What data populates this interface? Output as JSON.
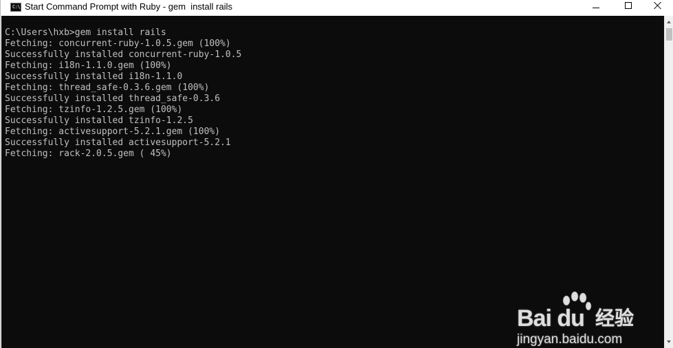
{
  "window": {
    "title": "Start Command Prompt with Ruby - gem  install rails",
    "icon": "cmd-app-icon",
    "icon_text": "C:\\"
  },
  "controls": {
    "minimize": "minimize-icon",
    "maximize": "maximize-icon",
    "close": "close-icon"
  },
  "console": {
    "background": "#0c0c0c",
    "foreground": "#c0c0c0",
    "lines": [
      "C:\\Users\\hxb>gem install rails",
      "Fetching: concurrent-ruby-1.0.5.gem (100%)",
      "Successfully installed concurrent-ruby-1.0.5",
      "Fetching: i18n-1.1.0.gem (100%)",
      "Successfully installed i18n-1.1.0",
      "Fetching: thread_safe-0.3.6.gem (100%)",
      "Successfully installed thread_safe-0.3.6",
      "Fetching: tzinfo-1.2.5.gem (100%)",
      "Successfully installed tzinfo-1.2.5",
      "Fetching: activesupport-5.2.1.gem (100%)",
      "Successfully installed activesupport-5.2.1",
      "Fetching: rack-2.0.5.gem ( 45%)"
    ]
  },
  "watermark": {
    "brand": "Bai du",
    "chinese": "经验",
    "url": "jingyan.baidu.com"
  }
}
